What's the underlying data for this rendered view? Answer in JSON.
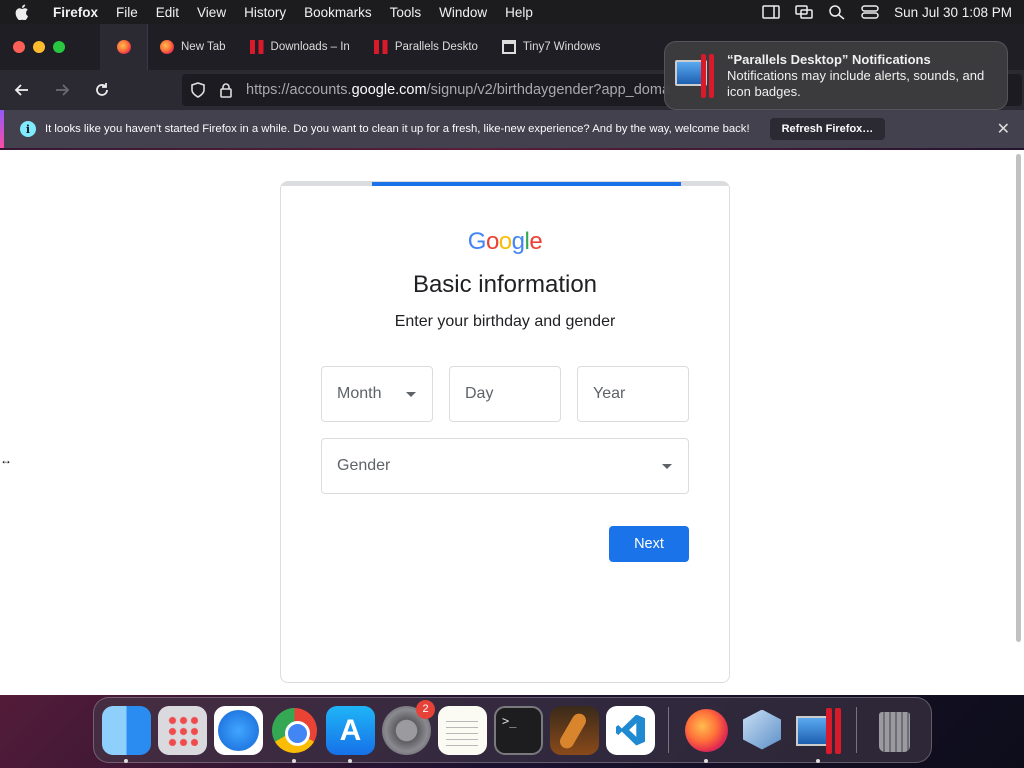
{
  "menubar": {
    "app_name": "Firefox",
    "items": [
      "File",
      "Edit",
      "View",
      "History",
      "Bookmarks",
      "Tools",
      "Window",
      "Help"
    ],
    "clock": "Sun Jul 30  1:08 PM"
  },
  "tabs": [
    {
      "title": "New Tab",
      "favicon": "firefox-icon"
    },
    {
      "title": "Downloads – In",
      "favicon": "parallels-icon"
    },
    {
      "title": "Parallels Deskto",
      "favicon": "parallels-icon"
    },
    {
      "title": "Tiny7 Windows",
      "favicon": "tiny7-icon"
    }
  ],
  "url": {
    "prefix": "https://accounts.",
    "host": "google.com",
    "path": "/signup/v2/birthdaygender?app_doma"
  },
  "infobar": {
    "message": "It looks like you haven't started Firefox in a while. Do you want to clean it up for a fresh, like-new experience? And by the way, welcome back!",
    "button": "Refresh Firefox…"
  },
  "notification": {
    "title": "“Parallels Desktop” Notifications",
    "body": "Notifications may include alerts, sounds, and icon badges."
  },
  "signup": {
    "logo": [
      "G",
      "o",
      "o",
      "g",
      "l",
      "e"
    ],
    "title": "Basic information",
    "subtitle": "Enter your birthday and gender",
    "month_label": "Month",
    "day_label": "Day",
    "year_label": "Year",
    "gender_label": "Gender",
    "next_button": "Next",
    "progress_fraction": 0.69
  },
  "dock": {
    "settings_badge": "2",
    "terminal_prompt": ">_"
  },
  "colors": {
    "google_blue": "#1a73e8",
    "firefox_toolbar": "#2b2a33",
    "badge_red": "#e64238"
  }
}
